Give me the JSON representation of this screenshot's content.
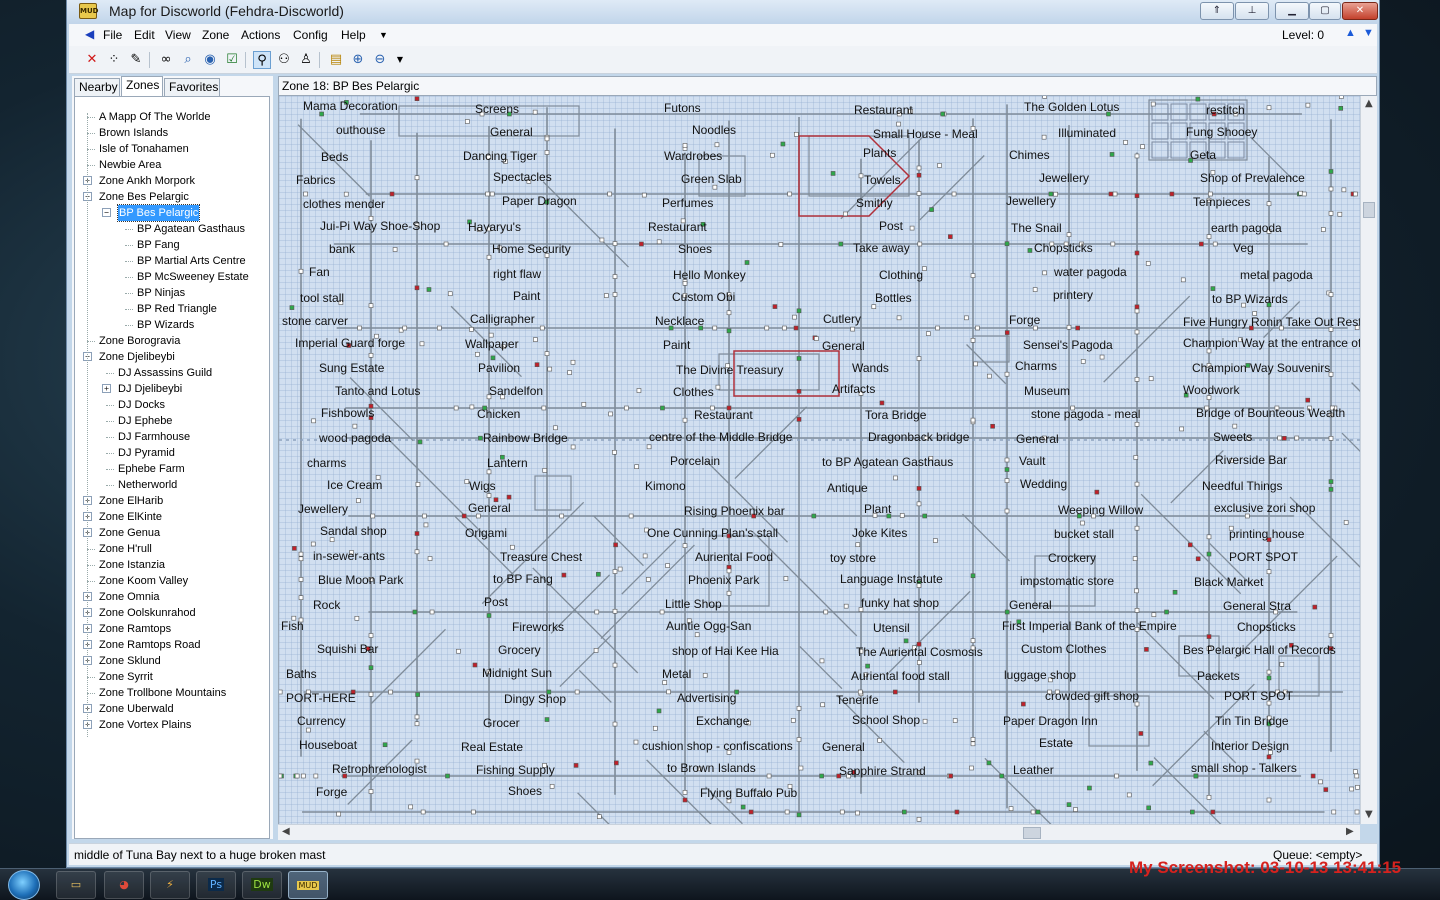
{
  "window": {
    "title": "Map for Discworld (Fehdra-Discworld)",
    "app_icon_text": "MUD"
  },
  "menu": {
    "items": [
      "File",
      "Edit",
      "View",
      "Zone",
      "Actions",
      "Config",
      "Help"
    ],
    "level_label": "Level: 0"
  },
  "toolbar": {
    "icons": [
      "delete-icon",
      "path-icon",
      "edit-icon",
      "binoculars-icon",
      "find-icon",
      "locate-icon",
      "checkbox-icon",
      "walk-icon",
      "run-icon",
      "person-icon",
      "map-icon",
      "zoom-in-icon",
      "zoom-out-icon"
    ]
  },
  "tabs": [
    "Nearby",
    "Zones",
    "Favorites"
  ],
  "active_tab": "Zones",
  "tree": [
    {
      "label": "A Mapp Of The Worlde",
      "depth": 0,
      "toggle": ""
    },
    {
      "label": "Brown Islands",
      "depth": 0,
      "toggle": ""
    },
    {
      "label": "Isle of Tonahamen",
      "depth": 0,
      "toggle": ""
    },
    {
      "label": "Newbie Area",
      "depth": 0,
      "toggle": ""
    },
    {
      "label": "Zone Ankh Morpork",
      "depth": 0,
      "toggle": "+"
    },
    {
      "label": "Zone Bes Pelargic",
      "depth": 0,
      "toggle": "-"
    },
    {
      "label": "BP Bes Pelargic",
      "depth": 1,
      "toggle": "-",
      "selected": true
    },
    {
      "label": "BP Agatean Gasthaus",
      "depth": 2,
      "toggle": ""
    },
    {
      "label": "BP Fang",
      "depth": 2,
      "toggle": ""
    },
    {
      "label": "BP Martial Arts Centre",
      "depth": 2,
      "toggle": ""
    },
    {
      "label": "BP McSweeney Estate",
      "depth": 2,
      "toggle": ""
    },
    {
      "label": "BP Ninjas",
      "depth": 2,
      "toggle": ""
    },
    {
      "label": "BP Red Triangle",
      "depth": 2,
      "toggle": ""
    },
    {
      "label": "BP Wizards",
      "depth": 2,
      "toggle": ""
    },
    {
      "label": "Zone Borogravia",
      "depth": 0,
      "toggle": ""
    },
    {
      "label": "Zone Djelibeybi",
      "depth": 0,
      "toggle": "-"
    },
    {
      "label": "DJ Assassins Guild",
      "depth": 1,
      "toggle": ""
    },
    {
      "label": "DJ Djelibeybi",
      "depth": 1,
      "toggle": "+"
    },
    {
      "label": "DJ Docks",
      "depth": 1,
      "toggle": ""
    },
    {
      "label": "DJ Ephebe",
      "depth": 1,
      "toggle": ""
    },
    {
      "label": "DJ Farmhouse",
      "depth": 1,
      "toggle": ""
    },
    {
      "label": "DJ Pyramid",
      "depth": 1,
      "toggle": ""
    },
    {
      "label": "Ephebe Farm",
      "depth": 1,
      "toggle": ""
    },
    {
      "label": "Netherworld",
      "depth": 1,
      "toggle": ""
    },
    {
      "label": "Zone ElHarib",
      "depth": 0,
      "toggle": "+"
    },
    {
      "label": "Zone ElKinte",
      "depth": 0,
      "toggle": "+"
    },
    {
      "label": "Zone Genua",
      "depth": 0,
      "toggle": "+"
    },
    {
      "label": "Zone H'rull",
      "depth": 0,
      "toggle": ""
    },
    {
      "label": "Zone Istanzia",
      "depth": 0,
      "toggle": ""
    },
    {
      "label": "Zone Koom Valley",
      "depth": 0,
      "toggle": ""
    },
    {
      "label": "Zone Omnia",
      "depth": 0,
      "toggle": "+"
    },
    {
      "label": "Zone Oolskunrahod",
      "depth": 0,
      "toggle": "+"
    },
    {
      "label": "Zone Ramtops",
      "depth": 0,
      "toggle": "+"
    },
    {
      "label": "Zone Ramtops Road",
      "depth": 0,
      "toggle": "+"
    },
    {
      "label": "Zone Sklund",
      "depth": 0,
      "toggle": "+"
    },
    {
      "label": "Zone Syrrit",
      "depth": 0,
      "toggle": ""
    },
    {
      "label": "Zone Trollbone Mountains",
      "depth": 0,
      "toggle": ""
    },
    {
      "label": "Zone Uberwald",
      "depth": 0,
      "toggle": "+"
    },
    {
      "label": "Zone Vortex Plains",
      "depth": 0,
      "toggle": "+"
    }
  ],
  "map": {
    "zone_title": "Zone 18: BP Bes Pelargic",
    "labels": [
      "Mama Decoration",
      "Screens",
      "Futons",
      "Restaurant",
      "The Golden Lotus",
      "restitch",
      "outhouse",
      "General",
      "Noodles",
      "Small House - Meal",
      "Illuminated",
      "Fung Shooey",
      "Beds",
      "Dancing Tiger",
      "Wardrobes",
      "Plants",
      "Chimes",
      "Geta",
      "Fabrics",
      "Spectacles",
      "Green Slab",
      "Towels",
      "Jewellery",
      "Shop of Prevalence",
      "clothes mender",
      "Paper Dragon",
      "Perfumes",
      "Smithy",
      "Jewellery",
      "Tempieces",
      "Jui-Pi Way Shoe-Shop",
      "Hayaryu's",
      "Restaurant",
      "Post",
      "The Snail",
      "earth pagoda",
      "bank",
      "Home Security",
      "Shoes",
      "Take away",
      "Chopsticks",
      "Veg",
      "Fan",
      "right flaw",
      "Hello Monkey",
      "Clothing",
      "water pagoda",
      "metal pagoda",
      "tool stall",
      "Paint",
      "Custom Obi",
      "Bottles",
      "printery",
      "to BP Wizards",
      "stone carver",
      "Calligrapher",
      "Necklace",
      "Cutlery",
      "Forge",
      "Five Hungry Ronin Take Out Restaurant",
      "Imperial Guard forge",
      "Wallpaper",
      "Paint",
      "General",
      "Sensei's Pagoda",
      "Champion Way at the entrance of Champion Stadium",
      "Sung Estate",
      "Pavilion",
      "The Divine Treasury",
      "Wands",
      "Charms",
      "Champion Way Souvenirs",
      "Tanto and Lotus",
      "Sandelfon",
      "Clothes",
      "Artifacts",
      "Museum",
      "Woodwork",
      "Fishbowls",
      "Chicken",
      "Restaurant",
      "Tora Bridge",
      "stone pagoda - meal",
      "Bridge of Bounteous Wealth",
      "wood pagoda",
      "Rainbow Bridge",
      "centre of the Middle Bridge",
      "Dragonback bridge",
      "General",
      "Sweets",
      "charms",
      "Lantern",
      "Porcelain",
      "to BP Agatean Gasthaus",
      "Vault",
      "Riverside Bar",
      "Ice Cream",
      "Wigs",
      "Kimono",
      "Antique",
      "Wedding",
      "Needful Things",
      "Jewellery",
      "General",
      "Rising Phoenix bar",
      "Plant",
      "Weeping Willow",
      "exclusive zori shop",
      "Sandal shop",
      "Origami",
      "One Cunning Plan's stall",
      "Joke Kites",
      "bucket stall",
      "printing house",
      "in-sewer-ants",
      "Treasure Chest",
      "Auriental Food",
      "toy store",
      "Crockery",
      "PORT SPOT",
      "Blue Moon Park",
      "to BP Fang",
      "Phoenix Park",
      "Language Instatute",
      "impstomatic store",
      "Black Market",
      "Rock",
      "Post",
      "Little Shop",
      "funky hat shop",
      "General",
      "General Stra",
      "Fish",
      "Fireworks",
      "Auntie Ogg-San",
      "Utensil",
      "First Imperial Bank of the Empire",
      "Chopsticks",
      "Squishi Bar",
      "Grocery",
      "shop of Hai Kee Hia",
      "The Auriental Cosmosis",
      "Custom Clothes",
      "Bes Pelargic Hall of Records",
      "Baths",
      "Midnight Sun",
      "Metal",
      "Auriental food stall",
      "luggage shop",
      "Packets",
      "PORT-HERE",
      "Dingy Shop",
      "Advertising",
      "Tenerife",
      "crowded gift shop",
      "PORT SPOT",
      "Currency",
      "Grocer",
      "Exchange",
      "School Shop",
      "Paper Dragon Inn",
      "Tin Tin Bridge",
      "Houseboat",
      "Real Estate",
      "cushion shop - confiscations",
      "General",
      "Estate",
      "Interior Design",
      "Retrophrenologist",
      "Fishing Supply",
      "to Brown Islands",
      "Sapphire Strand",
      "Leather",
      "small shop - Talkers",
      "Forge",
      "Shoes",
      "Flying Buffalo Pub"
    ]
  },
  "status": {
    "message": "middle of Tuna Bay next to a huge broken mast",
    "queue": "Queue: <empty>"
  },
  "taskbar": {
    "apps": [
      "Explorer",
      "Chrome",
      "Winamp",
      "Photoshop",
      "Dreamweaver",
      "MUD"
    ]
  },
  "screenshot_stamp": "My Screenshot: 03-10-13 13:41:15"
}
